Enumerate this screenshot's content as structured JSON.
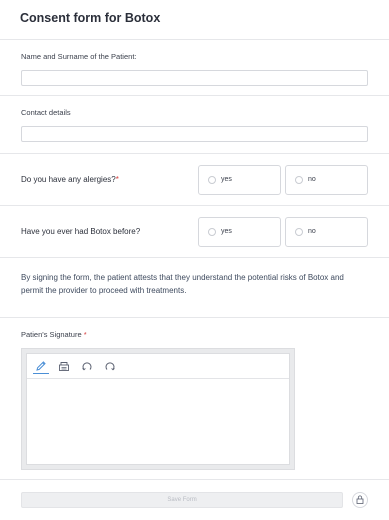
{
  "form": {
    "title": "Consent form for Botox",
    "name_field": {
      "label": "Name and Surname of the Patient:",
      "value": ""
    },
    "contact_field": {
      "label": "Contact details",
      "value": ""
    },
    "questions": [
      {
        "label": "Do you have any alergies?",
        "required_mark": "*",
        "options": [
          "yes",
          "no"
        ]
      },
      {
        "label": "Have you ever had Botox before?",
        "required_mark": "",
        "options": [
          "yes",
          "no"
        ]
      }
    ],
    "statement": "By signing the form, the patient attests that they understand the potential risks of Botox and permit the provider to proceed with treatments.",
    "signature": {
      "label": "Patien's Signature",
      "required_mark": "*",
      "tools": [
        "pen-icon",
        "eraser-icon",
        "undo-icon",
        "redo-icon"
      ]
    },
    "save_label": "Save Form",
    "colors": {
      "accent": "#4b8fd6",
      "required": "#d63b3b",
      "text": "#2b2f3a"
    }
  }
}
